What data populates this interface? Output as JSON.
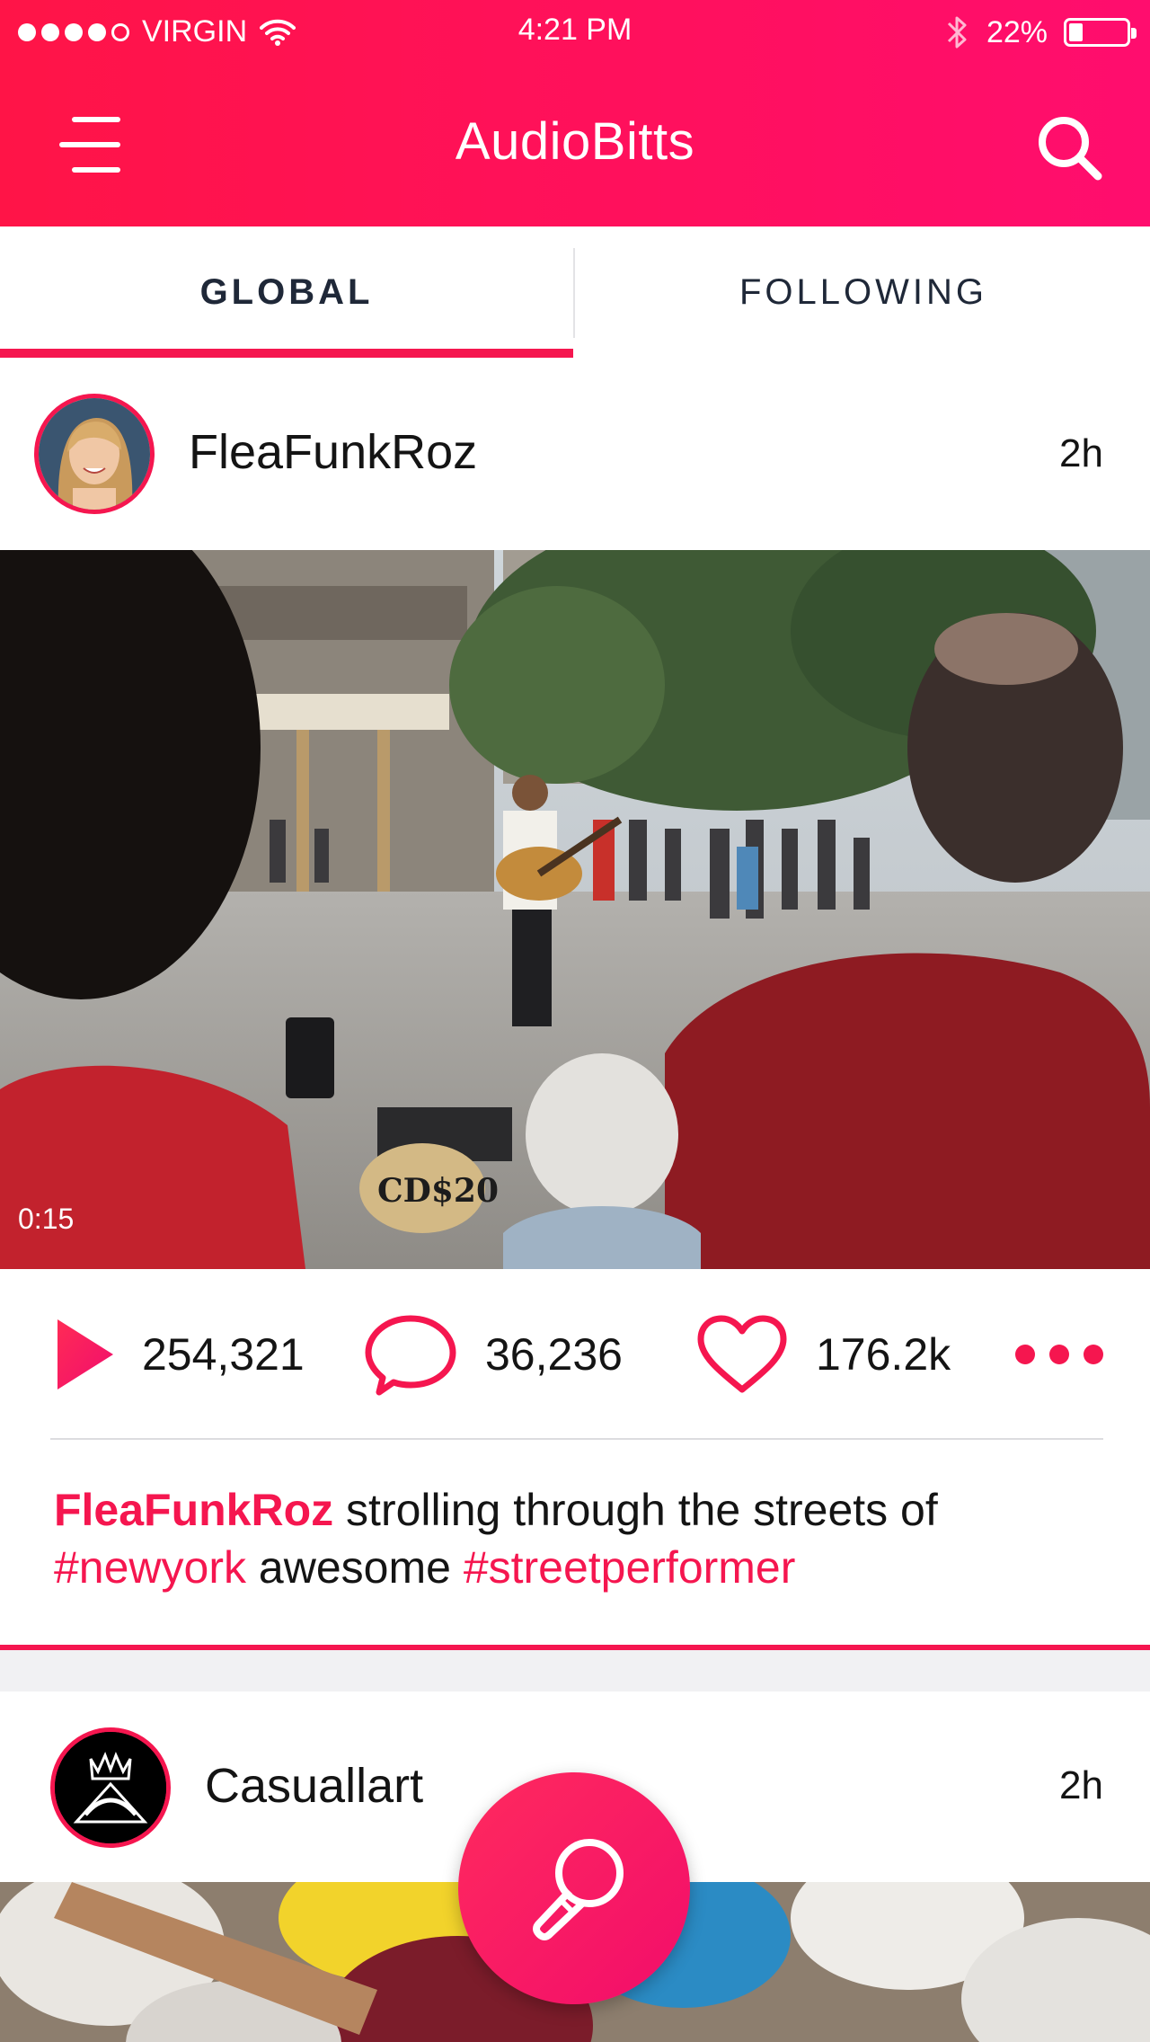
{
  "status_bar": {
    "carrier": "VIRGIN",
    "time": "4:21 PM",
    "battery_text": "22%",
    "battery_level": 0.22
  },
  "app": {
    "title": "AudioBitts",
    "accent_color": "#f5164f",
    "header_gradient": [
      "#ff1447",
      "#ff0d6e"
    ]
  },
  "tabs": [
    {
      "label": "GLOBAL",
      "active": true
    },
    {
      "label": "FOLLOWING",
      "active": false
    }
  ],
  "posts": [
    {
      "username": "FleaFunkRoz",
      "age": "2h",
      "duration": "0:15",
      "stats": {
        "plays": "254,321",
        "comments": "36,236",
        "likes": "176.2k"
      },
      "caption": {
        "user": "FleaFunkRoz",
        "part1": "strolling through the streets of",
        "tag1": "#newyork",
        "part2": "awesome",
        "tag2": "#streetperformer"
      }
    },
    {
      "username": "Casuallart",
      "age": "2h"
    }
  ],
  "icons": {
    "menu": "menu-icon",
    "search": "search-icon",
    "wifi": "wifi-icon",
    "bluetooth": "bluetooth-icon",
    "play": "play-icon",
    "comment": "comment-icon",
    "heart": "heart-icon",
    "more": "more-icon",
    "microphone": "microphone-icon"
  }
}
